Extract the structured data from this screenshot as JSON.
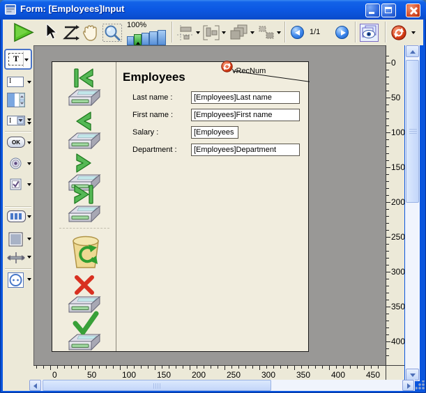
{
  "window": {
    "title": "Form: [Employees]Input"
  },
  "toolbar": {
    "zoom_level": "100%",
    "page_indicator": "1/1"
  },
  "palette": {
    "text_tool_glyph": "T",
    "input_tool_glyph": "I",
    "combo_tool_glyph": "I",
    "ok_button_glyph": "OK"
  },
  "form": {
    "title": "Employees",
    "variable_annotation": "vRecNum",
    "fields": [
      {
        "label": "Last name :",
        "value": "[Employees]Last name"
      },
      {
        "label": "First name :",
        "value": "[Employees]First name"
      },
      {
        "label": "Salary :",
        "value": "[Employees"
      },
      {
        "label": "Department :",
        "value": "[Employees]Department"
      }
    ]
  },
  "rulers": {
    "horizontal_labels": [
      "0",
      "50",
      "100",
      "150",
      "200",
      "250",
      "300",
      "350",
      "400",
      "450"
    ],
    "vertical_labels": [
      "0",
      "50",
      "100",
      "150",
      "200",
      "250",
      "300",
      "350",
      "400"
    ]
  },
  "colors": {
    "titlebar_blue": "#0c59e4",
    "toolbar_beige": "#ece9d8",
    "canvas_gray": "#999896",
    "page_cream": "#f1edde",
    "accent_green": "#3fae49",
    "accent_red": "#c82808"
  }
}
